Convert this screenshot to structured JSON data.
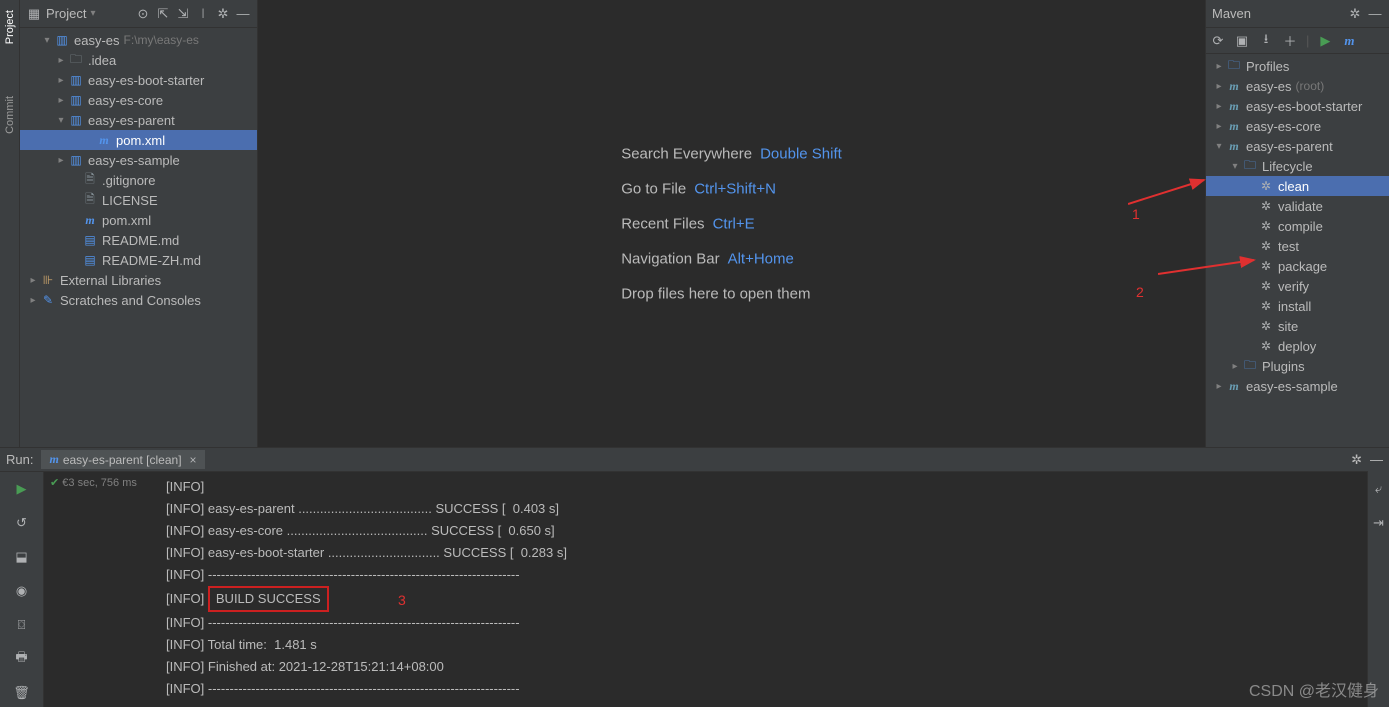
{
  "project_panel": {
    "title": "Project",
    "root": {
      "name": "easy-es",
      "path": "F:\\my\\easy-es"
    },
    "items": [
      {
        "indent": 1,
        "arrow": "v",
        "icon": "mod",
        "label": "easy-es",
        "hint": "F:\\my\\easy-es"
      },
      {
        "indent": 2,
        "arrow": ">",
        "icon": "folder",
        "label": ".idea"
      },
      {
        "indent": 2,
        "arrow": ">",
        "icon": "mod",
        "label": "easy-es-boot-starter"
      },
      {
        "indent": 2,
        "arrow": ">",
        "icon": "mod",
        "label": "easy-es-core"
      },
      {
        "indent": 2,
        "arrow": "v",
        "icon": "mod",
        "label": "easy-es-parent"
      },
      {
        "indent": 4,
        "arrow": "",
        "icon": "maven",
        "label": "pom.xml",
        "selected": true
      },
      {
        "indent": 2,
        "arrow": ">",
        "icon": "mod",
        "label": "easy-es-sample"
      },
      {
        "indent": 3,
        "arrow": "",
        "icon": "file",
        "label": ".gitignore"
      },
      {
        "indent": 3,
        "arrow": "",
        "icon": "file",
        "label": "LICENSE"
      },
      {
        "indent": 3,
        "arrow": "",
        "icon": "maven",
        "label": "pom.xml"
      },
      {
        "indent": 3,
        "arrow": "",
        "icon": "md",
        "label": "README.md"
      },
      {
        "indent": 3,
        "arrow": "",
        "icon": "md",
        "label": "README-ZH.md"
      },
      {
        "indent": 0,
        "arrow": ">",
        "icon": "lib",
        "label": "External Libraries"
      },
      {
        "indent": 0,
        "arrow": ">",
        "icon": "scratch",
        "label": "Scratches and Consoles"
      }
    ]
  },
  "welcome": {
    "rows": [
      {
        "text": "Search Everywhere",
        "key": "Double Shift"
      },
      {
        "text": "Go to File",
        "key": "Ctrl+Shift+N"
      },
      {
        "text": "Recent Files",
        "key": "Ctrl+E"
      },
      {
        "text": "Navigation Bar",
        "key": "Alt+Home"
      },
      {
        "text": "Drop files here to open them",
        "key": ""
      }
    ]
  },
  "maven": {
    "title": "Maven",
    "items": [
      {
        "indent": 0,
        "arrow": ">",
        "icon": "folder-p",
        "label": "Profiles"
      },
      {
        "indent": 0,
        "arrow": ">",
        "icon": "mvn",
        "label": "easy-es",
        "hint": "(root)"
      },
      {
        "indent": 0,
        "arrow": ">",
        "icon": "mvn",
        "label": "easy-es-boot-starter"
      },
      {
        "indent": 0,
        "arrow": ">",
        "icon": "mvn",
        "label": "easy-es-core"
      },
      {
        "indent": 0,
        "arrow": "v",
        "icon": "mvn",
        "label": "easy-es-parent"
      },
      {
        "indent": 1,
        "arrow": "v",
        "icon": "folder-g",
        "label": "Lifecycle"
      },
      {
        "indent": 2,
        "arrow": "",
        "icon": "gear",
        "label": "clean",
        "selected": true
      },
      {
        "indent": 2,
        "arrow": "",
        "icon": "gear",
        "label": "validate"
      },
      {
        "indent": 2,
        "arrow": "",
        "icon": "gear",
        "label": "compile"
      },
      {
        "indent": 2,
        "arrow": "",
        "icon": "gear",
        "label": "test"
      },
      {
        "indent": 2,
        "arrow": "",
        "icon": "gear",
        "label": "package"
      },
      {
        "indent": 2,
        "arrow": "",
        "icon": "gear",
        "label": "verify"
      },
      {
        "indent": 2,
        "arrow": "",
        "icon": "gear",
        "label": "install"
      },
      {
        "indent": 2,
        "arrow": "",
        "icon": "gear",
        "label": "site"
      },
      {
        "indent": 2,
        "arrow": "",
        "icon": "gear",
        "label": "deploy"
      },
      {
        "indent": 1,
        "arrow": ">",
        "icon": "folder-p",
        "label": "Plugins"
      },
      {
        "indent": 0,
        "arrow": ">",
        "icon": "mvn",
        "label": "easy-es-sample"
      }
    ]
  },
  "run": {
    "label": "Run:",
    "tab": "easy-es-parent [clean]",
    "status": "3 sec, 756 ms",
    "lines": [
      "[INFO]",
      "[INFO] easy-es-parent ..................................... SUCCESS [  0.403 s]",
      "[INFO] easy-es-core ....................................... SUCCESS [  0.650 s]",
      "[INFO] easy-es-boot-starter ............................... SUCCESS [  0.283 s]",
      "[INFO] ------------------------------------------------------------------------",
      "[INFO] BUILD SUCCESS",
      "[INFO] ------------------------------------------------------------------------",
      "[INFO] Total time:  1.481 s",
      "[INFO] Finished at: 2021-12-28T15:21:14+08:00",
      "[INFO] ------------------------------------------------------------------------"
    ]
  },
  "annotations": {
    "n1": "1",
    "n2": "2",
    "n3": "3"
  },
  "watermark": "CSDN @老汉健身"
}
